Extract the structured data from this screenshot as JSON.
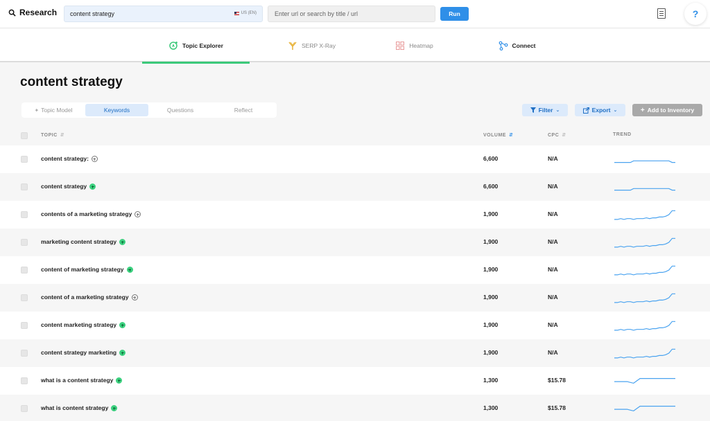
{
  "header": {
    "brand": "Research",
    "search_value": "content strategy",
    "locale": "US (EN)",
    "url_placeholder": "Enter url or search by title / url",
    "run_label": "Run",
    "help_label": "?"
  },
  "nav": {
    "tabs": [
      {
        "label": "Topic Explorer",
        "icon": "compass-icon",
        "active": true
      },
      {
        "label": "SERP X-Ray",
        "icon": "xray-icon",
        "active": false
      },
      {
        "label": "Heatmap",
        "icon": "grid-icon",
        "active": false
      },
      {
        "label": "Connect",
        "icon": "connect-icon",
        "active": false
      }
    ]
  },
  "page": {
    "title": "content strategy",
    "subtabs": [
      {
        "label": "Topic Model",
        "active": false
      },
      {
        "label": "Keywords",
        "active": true
      },
      {
        "label": "Questions",
        "active": false
      },
      {
        "label": "Reflect",
        "active": false
      }
    ],
    "filter_label": "Filter",
    "export_label": "Export",
    "add_label": "Add to Inventory"
  },
  "table": {
    "columns": {
      "topic": "TOPIC",
      "volume": "VOLUME",
      "cpc": "CPC",
      "trend": "TREND"
    },
    "rows": [
      {
        "keyword": "content strategy:",
        "added": false,
        "volume": "6,600",
        "cpc": "N/A",
        "trend": [
          3,
          3,
          3,
          3,
          3,
          3,
          5,
          5,
          5,
          5,
          5,
          5,
          5,
          5,
          5,
          5,
          5,
          5,
          3,
          3
        ]
      },
      {
        "keyword": "content strategy",
        "added": true,
        "volume": "6,600",
        "cpc": "N/A",
        "trend": [
          3,
          3,
          3,
          3,
          3,
          3,
          5,
          5,
          5,
          5,
          5,
          5,
          5,
          5,
          5,
          5,
          5,
          5,
          3,
          3
        ]
      },
      {
        "keyword": "contents of a marketing strategy",
        "added": false,
        "volume": "1,900",
        "cpc": "N/A",
        "trend": [
          1,
          1,
          2,
          1,
          2,
          2,
          1,
          2,
          2,
          2,
          3,
          2,
          3,
          3,
          4,
          4,
          5,
          7,
          12,
          12
        ]
      },
      {
        "keyword": "marketing content strategy",
        "added": true,
        "volume": "1,900",
        "cpc": "N/A",
        "trend": [
          1,
          1,
          2,
          1,
          2,
          2,
          1,
          2,
          2,
          2,
          3,
          2,
          3,
          3,
          4,
          4,
          5,
          7,
          12,
          12
        ]
      },
      {
        "keyword": "content of marketing strategy",
        "added": true,
        "volume": "1,900",
        "cpc": "N/A",
        "trend": [
          1,
          1,
          2,
          1,
          2,
          2,
          1,
          2,
          2,
          2,
          3,
          2,
          3,
          3,
          4,
          4,
          5,
          7,
          12,
          12
        ]
      },
      {
        "keyword": "content of a marketing strategy",
        "added": false,
        "volume": "1,900",
        "cpc": "N/A",
        "trend": [
          1,
          1,
          2,
          1,
          2,
          2,
          1,
          2,
          2,
          2,
          3,
          2,
          3,
          3,
          4,
          4,
          5,
          7,
          12,
          12
        ]
      },
      {
        "keyword": "content marketing strategy",
        "added": true,
        "volume": "1,900",
        "cpc": "N/A",
        "trend": [
          1,
          1,
          2,
          1,
          2,
          2,
          1,
          2,
          2,
          2,
          3,
          2,
          3,
          3,
          4,
          4,
          5,
          7,
          12,
          12
        ]
      },
      {
        "keyword": "content strategy marketing",
        "added": true,
        "volume": "1,900",
        "cpc": "N/A",
        "trend": [
          1,
          1,
          2,
          1,
          2,
          2,
          1,
          2,
          2,
          2,
          3,
          2,
          3,
          3,
          4,
          4,
          5,
          7,
          12,
          12
        ]
      },
      {
        "keyword": "what is a content strategy",
        "added": true,
        "volume": "1,300",
        "cpc": "$15.78",
        "trend": [
          6,
          6,
          6,
          6,
          6,
          5,
          4,
          7,
          10,
          10,
          10,
          10,
          10,
          10,
          10,
          10,
          10,
          10,
          10,
          10
        ]
      },
      {
        "keyword": "what is content strategy",
        "added": true,
        "volume": "1,300",
        "cpc": "$15.78",
        "trend": [
          6,
          6,
          6,
          6,
          6,
          5,
          4,
          7,
          10,
          10,
          10,
          10,
          10,
          10,
          10,
          10,
          10,
          10,
          10,
          10
        ]
      }
    ]
  },
  "colors": {
    "accent": "#2f8fe8",
    "green": "#3cc97a",
    "trend_line": "#4aa3f0"
  }
}
